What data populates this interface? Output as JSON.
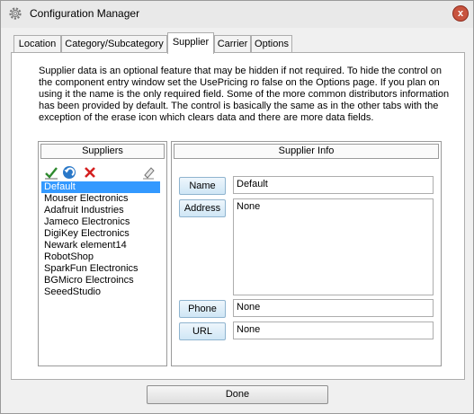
{
  "window": {
    "title": "Configuration Manager",
    "close_label": "x"
  },
  "tabs": [
    {
      "label": "Location"
    },
    {
      "label": "Category/Subcategory"
    },
    {
      "label": "Supplier"
    },
    {
      "label": "Carrier"
    },
    {
      "label": "Options"
    }
  ],
  "active_tab": "Supplier",
  "description": "Supplier data is  an optional feature that may be hidden if not required.  To hide the control on the component entry window set the UsePricing ro false on the Options page. If you plan on using it the name is the only required field.  Some of the more common distributors information has been provided by default. The control is basically the same as in the other tabs with the exception of the erase icon which clears data and there are more data fields.",
  "suppliers": {
    "header": "Suppliers",
    "toolbar_icons": [
      "checkmark-icon",
      "undo-icon",
      "delete-icon",
      "erase-icon"
    ],
    "items": [
      "Default",
      "Mouser Electronics",
      "Adafruit Industries",
      "Jameco Electronics",
      "DigiKey Electronics",
      "Newark element14",
      "RobotShop",
      "SparkFun Electronics",
      "BGMicro Electroincs",
      "SeeedStudio"
    ],
    "selected": "Default"
  },
  "supplier_info": {
    "header": "Supplier Info",
    "name": {
      "label": "Name",
      "value": "Default"
    },
    "address": {
      "label": "Address",
      "value": "None"
    },
    "phone": {
      "label": "Phone",
      "value": "None"
    },
    "url": {
      "label": "URL",
      "value": "None"
    }
  },
  "done_label": "Done",
  "colors": {
    "selection": "#3399ff",
    "close_button": "#c8543f",
    "field_button": "#cfe6f5"
  }
}
